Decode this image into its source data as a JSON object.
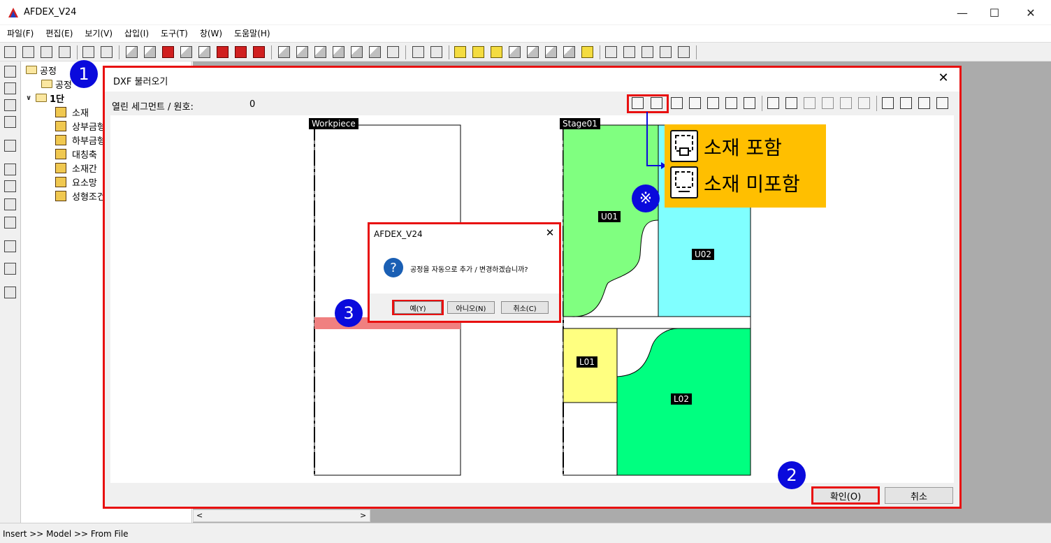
{
  "app": {
    "title": "AFDEX_V24",
    "minimize": "—",
    "maximize": "☐",
    "close": "✕"
  },
  "menu": [
    "파일(F)",
    "편집(E)",
    "보기(V)",
    "삽입(I)",
    "도구(T)",
    "창(W)",
    "도움말(H)"
  ],
  "tree": {
    "root": "공정",
    "child1": "공정",
    "stage": "1단",
    "items": [
      "소재",
      "상부금형",
      "하부금형",
      "대칭축",
      "소재간",
      "요소망",
      "성형조건"
    ]
  },
  "status": "Insert >> Model >> From File",
  "dialog": {
    "title": "DXF 불러오기",
    "close": "✕",
    "segment_label": "열린 세그먼트 / 원호:",
    "segment_value": "0",
    "ok_label": "확인(O)",
    "cancel_label": "취소"
  },
  "canvas": {
    "workpiece_label": "Workpiece",
    "stage_label": "Stage01",
    "regions": [
      "U01",
      "U02",
      "L01",
      "L02"
    ],
    "colors": {
      "U01": "#80ff80",
      "U02": "#80ffff",
      "L01": "#ffff80",
      "L02": "#00ff80",
      "strip": "#f08080"
    }
  },
  "msgbox": {
    "title": "AFDEX_V24",
    "close": "✕",
    "icon": "?",
    "text": "공정을 자동으로 추가 / 변경하겠습니까?",
    "yes": "예(Y)",
    "no": "아니오(N)",
    "cancel": "취소(C)"
  },
  "callouts": [
    "1",
    "2",
    "3",
    "※"
  ],
  "legend": {
    "include": "소재 포함",
    "exclude": "소재 미포함"
  },
  "accent_colors": {
    "highlight_red": "#e81010",
    "callout_blue": "#0a0adc",
    "legend_bg": "#ffbf00"
  }
}
